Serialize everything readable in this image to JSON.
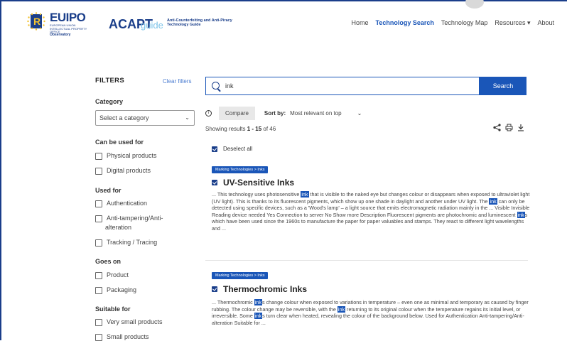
{
  "header": {
    "logo_text": "EUIPO",
    "logo_sub": "EUROPEAN UNION INTELLECTUAL PROPERTY OFFICE",
    "logo_obs": "Observatory",
    "acapt": "ACAPT",
    "guide": "guide",
    "acapt_sub": "Anti-Counterfeiting and Anti-Piracy Technology Guide",
    "nav": [
      "Home",
      "Technology Search",
      "Technology Map",
      "Resources ▾",
      "About"
    ]
  },
  "filters": {
    "title": "FILTERS",
    "clear": "Clear filters",
    "category_label": "Category",
    "category_select": "Select a category",
    "groups": [
      {
        "label": "Can be used for",
        "items": [
          "Physical products",
          "Digital products"
        ]
      },
      {
        "label": "Used for",
        "items": [
          "Authentication",
          "Anti-tampering/Anti-",
          "alteration",
          "Tracking / Tracing"
        ]
      },
      {
        "label": "Goes on",
        "items": [
          "Product",
          "Packaging"
        ]
      },
      {
        "label": "Suitable for",
        "items": [
          "Very small products",
          "Small products"
        ]
      }
    ]
  },
  "search": {
    "value": "ink",
    "button": "Search"
  },
  "toolbar": {
    "info": "i",
    "compare": "Compare",
    "sort_label": "Sort by:",
    "sort_value": "Most relevant on top",
    "sort_chevron": "⌄"
  },
  "results": {
    "prefix": "Showing results ",
    "range": "1 - 15",
    "suffix": " of 46",
    "deselect": "Deselect all",
    "icons": [
      "share-icon",
      "print-icon",
      "download-icon"
    ],
    "items": [
      {
        "tag": "Marking Technologies > Inks",
        "title": "UV-Sensitive Inks",
        "desc_parts": [
          "... This technology uses photosensitive ",
          "ink",
          " that is visible to the naked eye but changes colour or disappears when exposed to ultraviolet light (UV light). This is thanks to its fluorescent pigments, which show up one shade in daylight and another under UV light. The ",
          "ink",
          " can only be detected using specific devices, such as a 'Wood's lamp' – a light source that emits electromagnetic radiation mainly in the ... Visible Invisible Reading device needed Yes Connection to server No Show more Description Fluorescent pigments are photochromic and luminescent ",
          "ink",
          "s which have been used since the 1960s to manufacture the paper for paper valuables and stamps. They react to different light wavelengths and ..."
        ]
      },
      {
        "tag": "Marking Technologies > Inks",
        "title": "Thermochromic Inks",
        "desc_parts": [
          "... Thermochromic ",
          "ink",
          "s change colour when exposed to variations in temperature – even one as minimal and temporary as caused by finger rubbing. The colour change may be reversible, with the ",
          "ink",
          " returning to its original colour when the temperature regains its initial level, or irreversible. Some ",
          "ink",
          "s turn clear when heated, revealing the colour of the background below. Used for Authentication Anti-tampering/Anti-alteration Suitable for ..."
        ]
      }
    ]
  }
}
